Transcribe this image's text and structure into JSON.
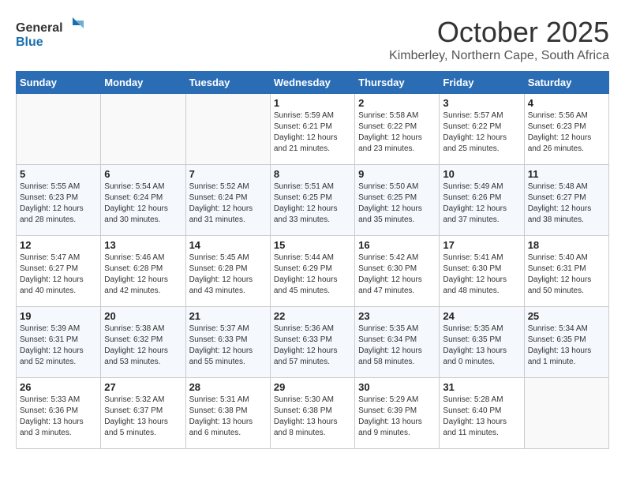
{
  "logo": {
    "line1": "General",
    "line2": "Blue"
  },
  "title": "October 2025",
  "subtitle": "Kimberley, Northern Cape, South Africa",
  "weekdays": [
    "Sunday",
    "Monday",
    "Tuesday",
    "Wednesday",
    "Thursday",
    "Friday",
    "Saturday"
  ],
  "weeks": [
    [
      {
        "day": "",
        "info": ""
      },
      {
        "day": "",
        "info": ""
      },
      {
        "day": "",
        "info": ""
      },
      {
        "day": "1",
        "info": "Sunrise: 5:59 AM\nSunset: 6:21 PM\nDaylight: 12 hours\nand 21 minutes."
      },
      {
        "day": "2",
        "info": "Sunrise: 5:58 AM\nSunset: 6:22 PM\nDaylight: 12 hours\nand 23 minutes."
      },
      {
        "day": "3",
        "info": "Sunrise: 5:57 AM\nSunset: 6:22 PM\nDaylight: 12 hours\nand 25 minutes."
      },
      {
        "day": "4",
        "info": "Sunrise: 5:56 AM\nSunset: 6:23 PM\nDaylight: 12 hours\nand 26 minutes."
      }
    ],
    [
      {
        "day": "5",
        "info": "Sunrise: 5:55 AM\nSunset: 6:23 PM\nDaylight: 12 hours\nand 28 minutes."
      },
      {
        "day": "6",
        "info": "Sunrise: 5:54 AM\nSunset: 6:24 PM\nDaylight: 12 hours\nand 30 minutes."
      },
      {
        "day": "7",
        "info": "Sunrise: 5:52 AM\nSunset: 6:24 PM\nDaylight: 12 hours\nand 31 minutes."
      },
      {
        "day": "8",
        "info": "Sunrise: 5:51 AM\nSunset: 6:25 PM\nDaylight: 12 hours\nand 33 minutes."
      },
      {
        "day": "9",
        "info": "Sunrise: 5:50 AM\nSunset: 6:25 PM\nDaylight: 12 hours\nand 35 minutes."
      },
      {
        "day": "10",
        "info": "Sunrise: 5:49 AM\nSunset: 6:26 PM\nDaylight: 12 hours\nand 37 minutes."
      },
      {
        "day": "11",
        "info": "Sunrise: 5:48 AM\nSunset: 6:27 PM\nDaylight: 12 hours\nand 38 minutes."
      }
    ],
    [
      {
        "day": "12",
        "info": "Sunrise: 5:47 AM\nSunset: 6:27 PM\nDaylight: 12 hours\nand 40 minutes."
      },
      {
        "day": "13",
        "info": "Sunrise: 5:46 AM\nSunset: 6:28 PM\nDaylight: 12 hours\nand 42 minutes."
      },
      {
        "day": "14",
        "info": "Sunrise: 5:45 AM\nSunset: 6:28 PM\nDaylight: 12 hours\nand 43 minutes."
      },
      {
        "day": "15",
        "info": "Sunrise: 5:44 AM\nSunset: 6:29 PM\nDaylight: 12 hours\nand 45 minutes."
      },
      {
        "day": "16",
        "info": "Sunrise: 5:42 AM\nSunset: 6:30 PM\nDaylight: 12 hours\nand 47 minutes."
      },
      {
        "day": "17",
        "info": "Sunrise: 5:41 AM\nSunset: 6:30 PM\nDaylight: 12 hours\nand 48 minutes."
      },
      {
        "day": "18",
        "info": "Sunrise: 5:40 AM\nSunset: 6:31 PM\nDaylight: 12 hours\nand 50 minutes."
      }
    ],
    [
      {
        "day": "19",
        "info": "Sunrise: 5:39 AM\nSunset: 6:31 PM\nDaylight: 12 hours\nand 52 minutes."
      },
      {
        "day": "20",
        "info": "Sunrise: 5:38 AM\nSunset: 6:32 PM\nDaylight: 12 hours\nand 53 minutes."
      },
      {
        "day": "21",
        "info": "Sunrise: 5:37 AM\nSunset: 6:33 PM\nDaylight: 12 hours\nand 55 minutes."
      },
      {
        "day": "22",
        "info": "Sunrise: 5:36 AM\nSunset: 6:33 PM\nDaylight: 12 hours\nand 57 minutes."
      },
      {
        "day": "23",
        "info": "Sunrise: 5:35 AM\nSunset: 6:34 PM\nDaylight: 12 hours\nand 58 minutes."
      },
      {
        "day": "24",
        "info": "Sunrise: 5:35 AM\nSunset: 6:35 PM\nDaylight: 13 hours\nand 0 minutes."
      },
      {
        "day": "25",
        "info": "Sunrise: 5:34 AM\nSunset: 6:35 PM\nDaylight: 13 hours\nand 1 minute."
      }
    ],
    [
      {
        "day": "26",
        "info": "Sunrise: 5:33 AM\nSunset: 6:36 PM\nDaylight: 13 hours\nand 3 minutes."
      },
      {
        "day": "27",
        "info": "Sunrise: 5:32 AM\nSunset: 6:37 PM\nDaylight: 13 hours\nand 5 minutes."
      },
      {
        "day": "28",
        "info": "Sunrise: 5:31 AM\nSunset: 6:38 PM\nDaylight: 13 hours\nand 6 minutes."
      },
      {
        "day": "29",
        "info": "Sunrise: 5:30 AM\nSunset: 6:38 PM\nDaylight: 13 hours\nand 8 minutes."
      },
      {
        "day": "30",
        "info": "Sunrise: 5:29 AM\nSunset: 6:39 PM\nDaylight: 13 hours\nand 9 minutes."
      },
      {
        "day": "31",
        "info": "Sunrise: 5:28 AM\nSunset: 6:40 PM\nDaylight: 13 hours\nand 11 minutes."
      },
      {
        "day": "",
        "info": ""
      }
    ]
  ]
}
